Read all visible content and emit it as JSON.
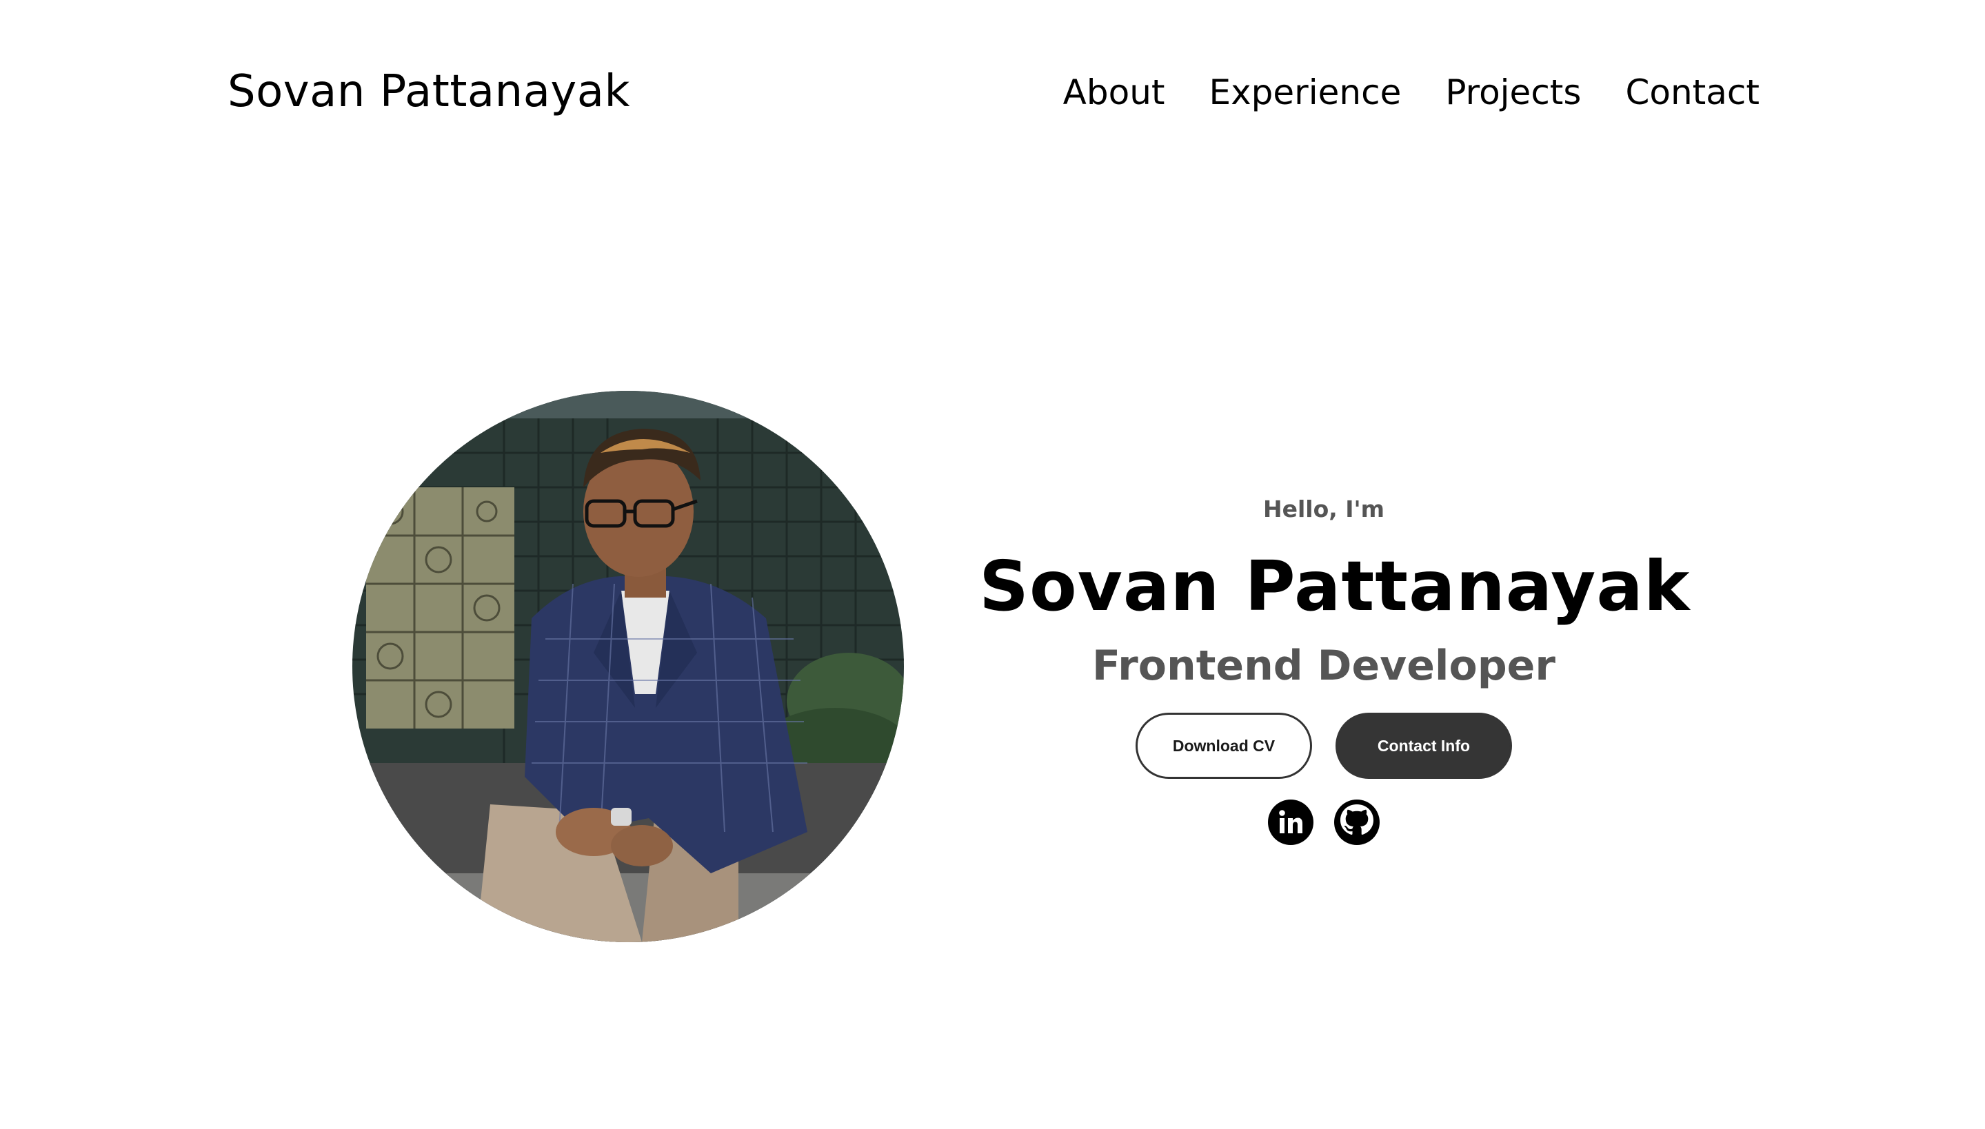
{
  "header": {
    "logo": "Sovan Pattanayak",
    "nav": [
      "About",
      "Experience",
      "Projects",
      "Contact"
    ]
  },
  "hero": {
    "greeting": "Hello, I'm",
    "name": "Sovan Pattanayak",
    "role": "Frontend Developer",
    "buttons": {
      "download": "Download CV",
      "contact": "Contact Info"
    },
    "social_icons": [
      "linkedin-icon",
      "github-icon"
    ]
  },
  "colors": {
    "text": "#000000",
    "muted": "#555555",
    "button_dark": "#353535",
    "background": "#ffffff"
  }
}
